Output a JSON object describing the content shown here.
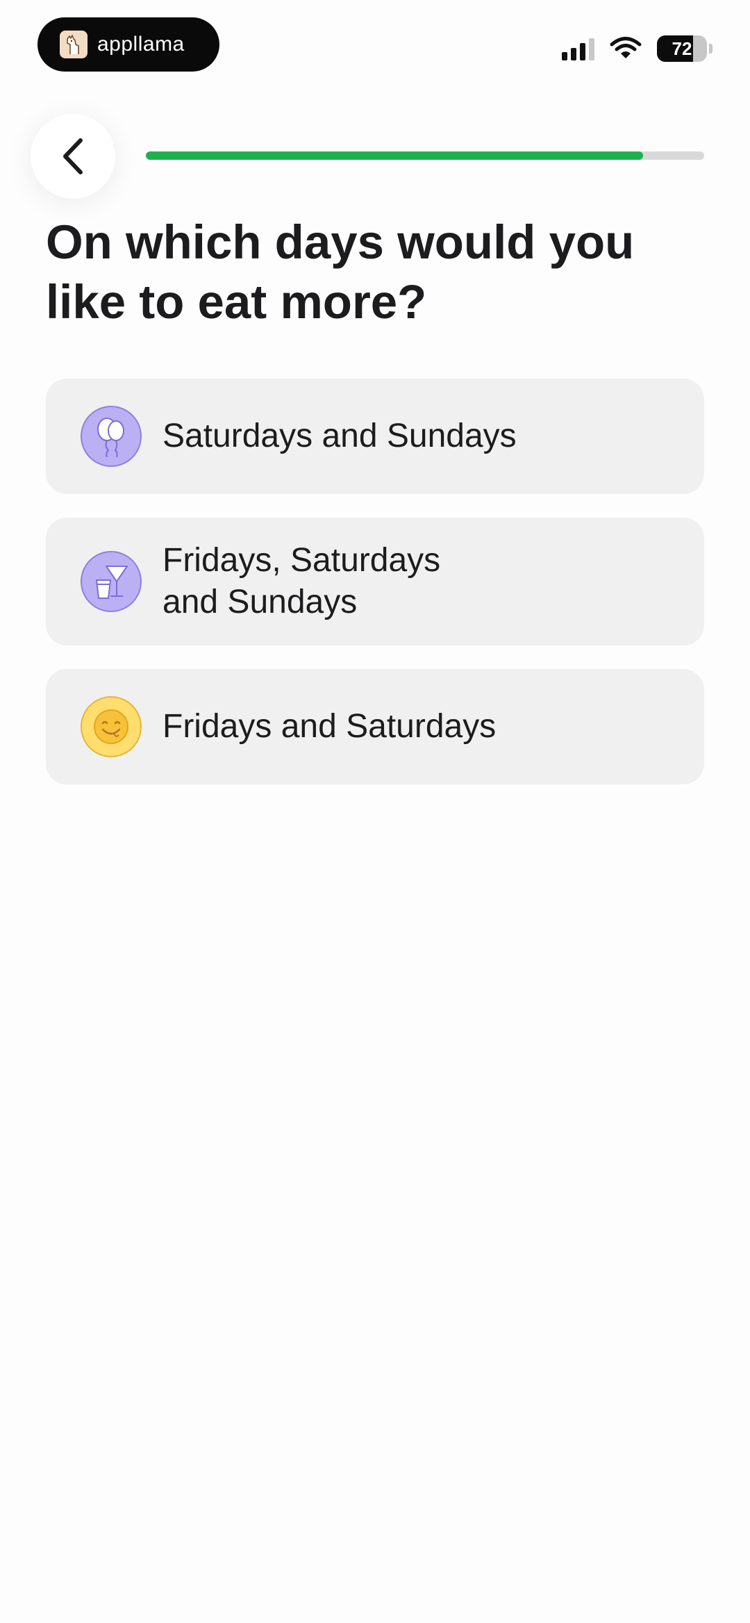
{
  "status_bar": {
    "app_name": "appllama",
    "battery_level": "72",
    "signal_bars_active": 3,
    "signal_bars_total": 4,
    "wifi": true
  },
  "header": {
    "back_icon": "chevron-left-icon",
    "progress_fraction": 0.89,
    "progress_color": "#1db24f"
  },
  "question": {
    "title": "On which days would you like to eat more?"
  },
  "options": [
    {
      "icon": "balloons-icon",
      "icon_color": "#bcb0f5",
      "lines": [
        "Saturdays and Sundays"
      ]
    },
    {
      "icon": "cocktail-glass-icon",
      "icon_color": "#bcb0f5",
      "lines": [
        "Fridays, Saturdays",
        "and Sundays"
      ]
    },
    {
      "icon": "smiley-face-icon",
      "icon_color": "#ffdd6e",
      "lines": [
        "Fridays and Saturdays"
      ]
    }
  ]
}
